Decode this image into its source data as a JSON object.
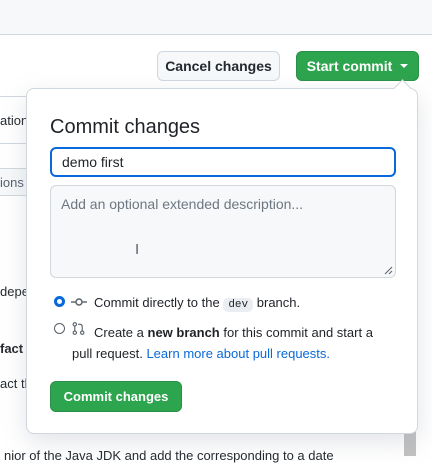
{
  "toolbar": {
    "cancel_label": "Cancel changes",
    "start_commit_label": "Start commit"
  },
  "background": {
    "frag_1": "ation",
    "frag_2": "ions",
    "frag_3": "depe",
    "frag_4": "fact",
    "frag_5": "act th",
    "frag_6": "nior of the Java JDK and add the corresponding to a date"
  },
  "commit_dialog": {
    "title": "Commit changes",
    "summary_value": "demo first",
    "description_placeholder": "Add an optional extended description...",
    "option_direct": {
      "prefix": "Commit directly to the",
      "branch": "dev",
      "suffix": "branch."
    },
    "option_new_branch": {
      "prefix": "Create a",
      "bold": "new branch",
      "mid": "for this commit and start a",
      "line2": "pull request.",
      "link": "Learn more about pull requests."
    },
    "submit_label": "Commit changes"
  }
}
